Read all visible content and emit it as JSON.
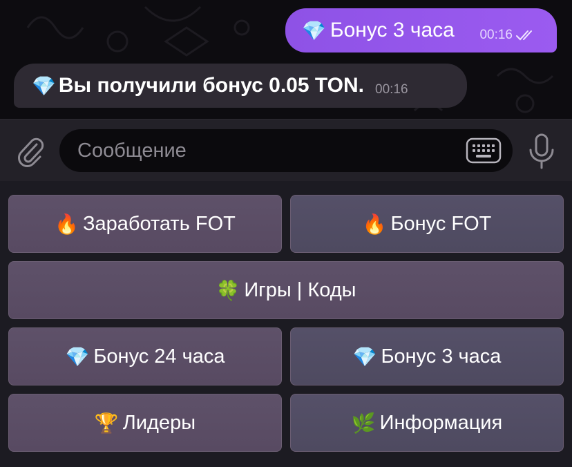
{
  "messages": {
    "outgoing": {
      "emoji": "💎",
      "text": "Бонус 3 часа",
      "time": "00:16",
      "status_icon": "double-check-icon"
    },
    "incoming": {
      "emoji": "💎",
      "text": "Вы получили бонус 0.05 TON.",
      "time": "00:16"
    }
  },
  "composer": {
    "placeholder": "Сообщение",
    "attach_icon": "paperclip-icon",
    "keyboard_icon": "keyboard-icon",
    "mic_icon": "microphone-icon"
  },
  "keyboard": {
    "buttons": [
      {
        "emoji": "🔥",
        "label": "Заработать FOT"
      },
      {
        "emoji": "🔥",
        "label": "Бонус FOT"
      },
      {
        "emoji": "🍀",
        "label": "Игры | Коды"
      },
      {
        "emoji": "💎",
        "label": "Бонус 24 часа"
      },
      {
        "emoji": "💎",
        "label": "Бонус 3 часа"
      },
      {
        "emoji": "🏆",
        "label": "Лидеры"
      },
      {
        "emoji": "🌿",
        "label": "Информация"
      }
    ]
  },
  "colors": {
    "outgoing_bubble": "#9354ea",
    "incoming_bubble": "#2e2a33",
    "keyboard_button": "#5a4d64",
    "background": "#1c1b22"
  }
}
